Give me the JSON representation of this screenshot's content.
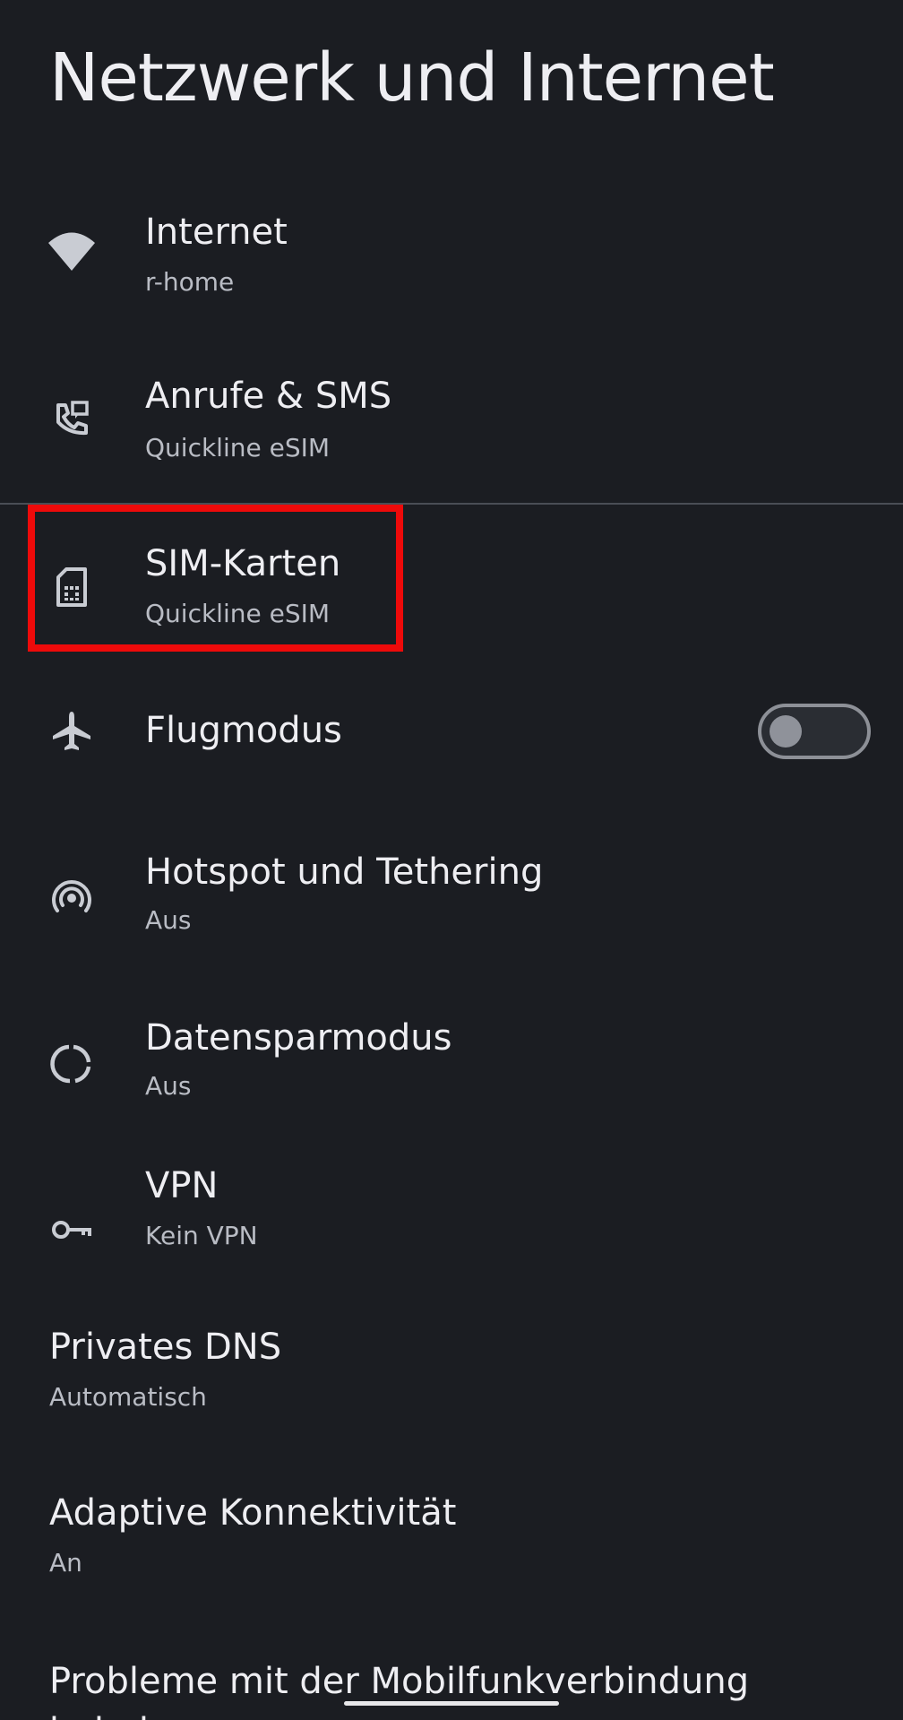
{
  "header": {
    "title": "Netzwerk und Internet"
  },
  "items": [
    {
      "icon": "wifi-icon",
      "label": "Internet",
      "subtitle": "r-home"
    },
    {
      "icon": "calls-sms-icon",
      "label": "Anrufe & SMS",
      "subtitle": "Quickline eSIM"
    },
    {
      "icon": "sim-card-icon",
      "label": "SIM-Karten",
      "subtitle": "Quickline eSIM"
    },
    {
      "icon": "airplane-icon",
      "label": "Flugmodus",
      "toggle_on": false
    },
    {
      "icon": "hotspot-icon",
      "label": "Hotspot und Tethering",
      "subtitle": "Aus"
    },
    {
      "icon": "data-saver-icon",
      "label": "Datensparmodus",
      "subtitle": "Aus"
    },
    {
      "icon": "vpn-key-icon",
      "label": "VPN",
      "subtitle": "Kein VPN"
    },
    {
      "label": "Privates DNS",
      "subtitle": "Automatisch"
    },
    {
      "label": "Adaptive Konnektivität",
      "subtitle": "An"
    },
    {
      "label": "Probleme mit der Mobilfunkverbindung beheben"
    }
  ],
  "colors": {
    "background": "#1b1d22",
    "highlight": "#ee0a0a",
    "text_primary": "#eeeef2",
    "text_secondary": "#b9bcc4"
  }
}
